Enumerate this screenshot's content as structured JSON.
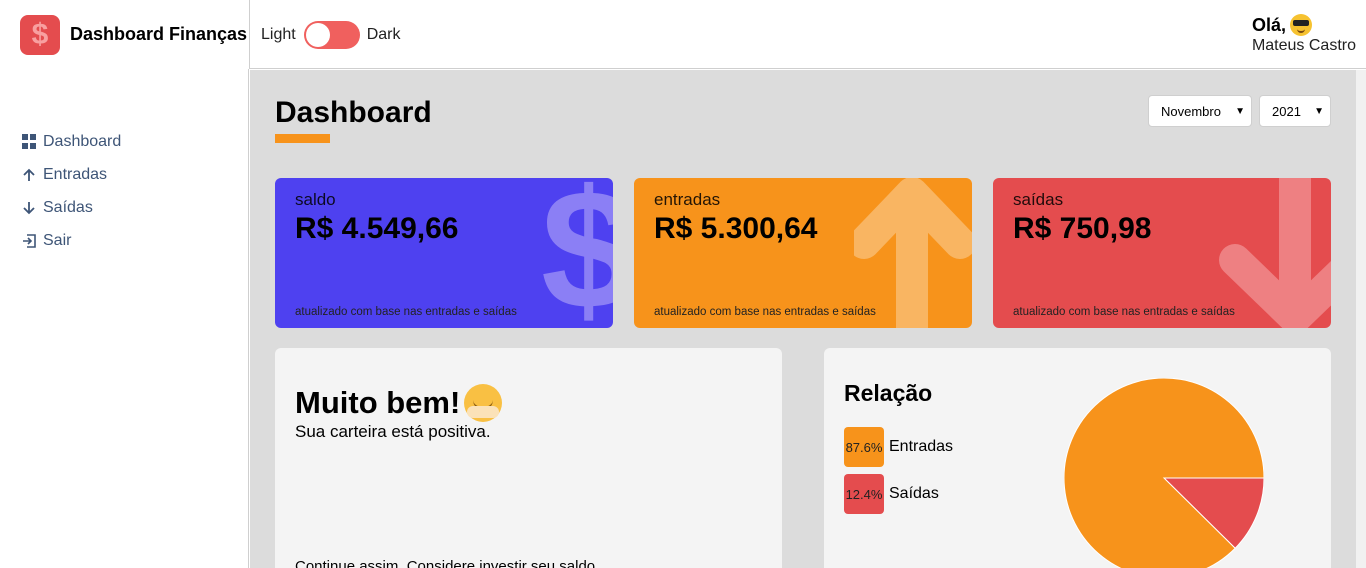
{
  "brand": {
    "logo_symbol": "$",
    "title": "Dashboard Finanças"
  },
  "theme_toggle": {
    "left_label": "Light",
    "right_label": "Dark"
  },
  "profile": {
    "greeting": "Olá,",
    "name": "Mateus Castro"
  },
  "sidebar": {
    "items": [
      {
        "label": "Dashboard",
        "icon": "grid-icon"
      },
      {
        "label": "Entradas",
        "icon": "arrow-up-icon"
      },
      {
        "label": "Saídas",
        "icon": "arrow-down-icon"
      },
      {
        "label": "Sair",
        "icon": "logout-icon"
      }
    ]
  },
  "page": {
    "title": "Dashboard"
  },
  "filters": {
    "month": "Novembro",
    "year": "2021"
  },
  "cards": [
    {
      "label": "saldo",
      "value": "R$ 4.549,66",
      "note": "atualizado com base nas entradas e saídas",
      "color": "#4e41f0",
      "icon": "dollar-icon"
    },
    {
      "label": "entradas",
      "value": "R$ 5.300,64",
      "note": "atualizado com base nas entradas e saídas",
      "color": "#f7931b",
      "icon": "arrow-up-icon"
    },
    {
      "label": "saídas",
      "value": "R$ 750,98",
      "note": "atualizado com base nas entradas e saídas",
      "color": "#e44c4e",
      "icon": "arrow-down-icon"
    }
  ],
  "message": {
    "title": "Muito bem!",
    "subtitle": "Sua carteira está positiva.",
    "footer": "Continue assim. Considere investir seu saldo."
  },
  "relation": {
    "title": "Relação",
    "items": [
      {
        "percent": "87.6%",
        "label": "Entradas",
        "value": 87.6,
        "color": "#f7931b"
      },
      {
        "percent": "12.4%",
        "label": "Saídas",
        "value": 12.4,
        "color": "#e44c4e"
      }
    ]
  }
}
